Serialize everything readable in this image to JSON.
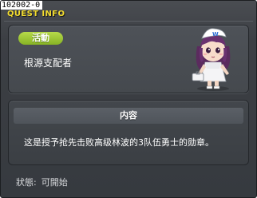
{
  "window": {
    "id_label": "102002-0",
    "title": "QUEST INFO"
  },
  "header": {
    "badge_label": "活動",
    "quest_name": "根源支配者",
    "npc_icon": "nurse-npc-icon"
  },
  "description": {
    "heading": "内容",
    "text": "这是授予抢先击败高级林波的3队伍勇士的勋章。"
  },
  "status": {
    "label": "狀態:",
    "value": "可開始"
  },
  "colors": {
    "title": "#f3dc2e",
    "badge": "#9cc735",
    "panel": "#45494e"
  }
}
